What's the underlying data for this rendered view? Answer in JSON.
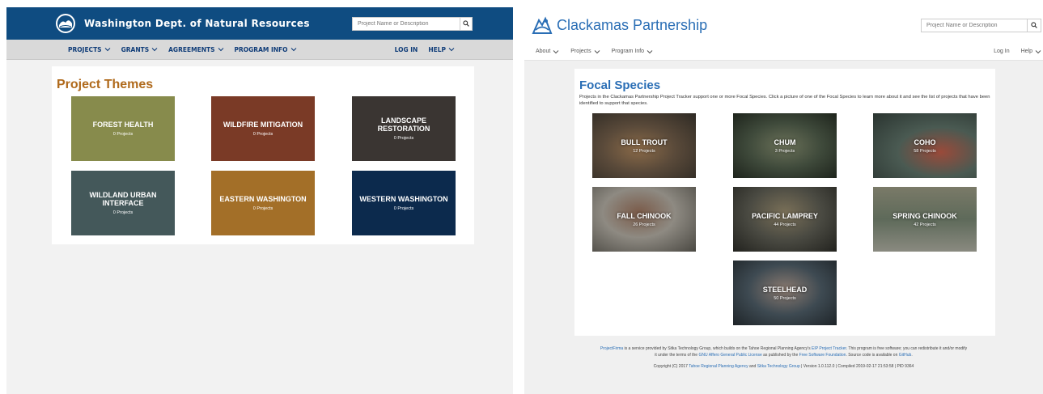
{
  "left_site": {
    "brand": "Washington Dept. of Natural Resources",
    "search_placeholder": "Project Name or Description",
    "nav_left": [
      "PROJECTS",
      "GRANTS",
      "AGREEMENTS",
      "PROGRAM INFO"
    ],
    "nav_right": [
      "LOG IN",
      "HELP"
    ],
    "page_title": "Project Themes",
    "themes": [
      {
        "name": "FOREST HEALTH",
        "count": "0 Projects",
        "color": "#878b4c"
      },
      {
        "name": "WILDFIRE MITIGATION",
        "count": "0 Projects",
        "color": "#7a3a26"
      },
      {
        "name": "LANDSCAPE RESTORATION",
        "count": "0 Projects",
        "color": "#3a3532"
      },
      {
        "name": "WILDLAND URBAN INTERFACE",
        "count": "0 Projects",
        "color": "#44585a"
      },
      {
        "name": "EASTERN WASHINGTON",
        "count": "0 Projects",
        "color": "#a36f28"
      },
      {
        "name": "WESTERN WASHINGTON",
        "count": "0 Projects",
        "color": "#0c2a4d"
      }
    ]
  },
  "right_site": {
    "brand": "Clackamas Partnership",
    "search_placeholder": "Project Name or Description",
    "nav_left": [
      "About",
      "Projects",
      "Program Info"
    ],
    "nav_right": [
      "Log In",
      "Help"
    ],
    "page_title": "Focal Species",
    "description": "Projects in the Clackamas Partnership Project Tracker support one or more Focal Species. Click a picture of one of the Focal Species to learn more about it and see the list of projects that have been identified to support that species.",
    "species": [
      {
        "name": "BULL TROUT",
        "count": "12 Projects",
        "color": "#5a4a3a"
      },
      {
        "name": "CHUM",
        "count": "3 Projects",
        "color": "#3f4a3b"
      },
      {
        "name": "COHO",
        "count": "58 Projects",
        "color": "#4a5a52"
      },
      {
        "name": "FALL CHINOOK",
        "count": "26 Projects",
        "color": "#6e6a62"
      },
      {
        "name": "PACIFIC LAMPREY",
        "count": "44 Projects",
        "color": "#4a4a42"
      },
      {
        "name": "SPRING CHINOOK",
        "count": "42 Projects",
        "color": "#5e6a5a"
      },
      {
        "name": "STEELHEAD",
        "count": "50 Projects",
        "color": "#3e4a52"
      }
    ],
    "footer": {
      "line1_a": "ProjectFirma",
      "line1_b": " is a service provided by Sitka Technology Group, which builds on the Tahoe Regional Planning Agency's ",
      "line1_c": "EIP Project Tracker",
      "line1_d": ". This program is free software; you can redistribute it and/or modify",
      "line2_a": "it under the terms of the ",
      "line2_b": "GNU Affero General Public License",
      "line2_c": " as published by the ",
      "line2_d": "Free Software Foundation",
      "line2_e": ". Source code is available on ",
      "line2_f": "GitHub",
      "line2_g": ".",
      "line3_a": "Copyright (C) 2017 ",
      "line3_b": "Tahoe Regional Planning Agency",
      "line3_c": " and ",
      "line3_d": "Sitka Technology Group",
      "line3_e": " | Version 1.0.112.0 | Compiled 2019-02-17 21:53:58 | PID 9364"
    }
  }
}
